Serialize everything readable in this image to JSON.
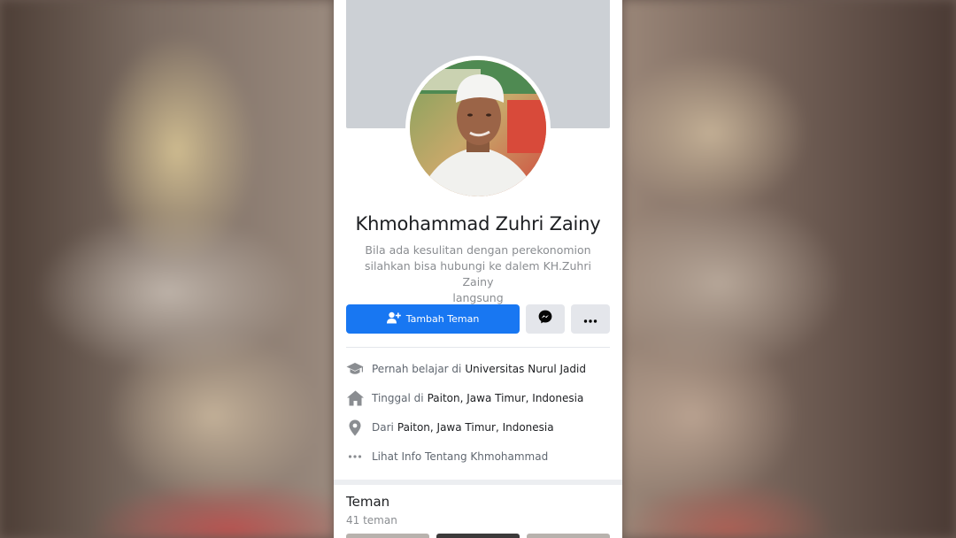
{
  "profile": {
    "name": "Khmohammad Zuhri Zainy",
    "bio_lines": [
      "Bila ada kesulitan dengan perekonomion",
      "silahkan bisa hubungi ke dalem KH.Zuhri Zainy",
      "langsung"
    ]
  },
  "actions": {
    "add_friend_label": "Tambah Teman",
    "add_friend_icon": "add-friend-icon",
    "message_icon": "messenger-icon",
    "more_icon": "more-icon"
  },
  "info": {
    "education_prefix": "Pernah belajar di",
    "education_value": "Universitas Nurul Jadid",
    "lives_prefix": "Tinggal di",
    "lives_value": "Paiton, Jawa Timur, Indonesia",
    "from_prefix": "Dari",
    "from_value": "Paiton, Jawa Timur, Indonesia",
    "see_more": "Lihat Info Tentang Khmohammad"
  },
  "friends": {
    "title": "Teman",
    "count": "41 teman"
  },
  "colors": {
    "accent": "#1877f2",
    "button_gray": "#e4e6eb",
    "cover": "#ccd0d5"
  }
}
